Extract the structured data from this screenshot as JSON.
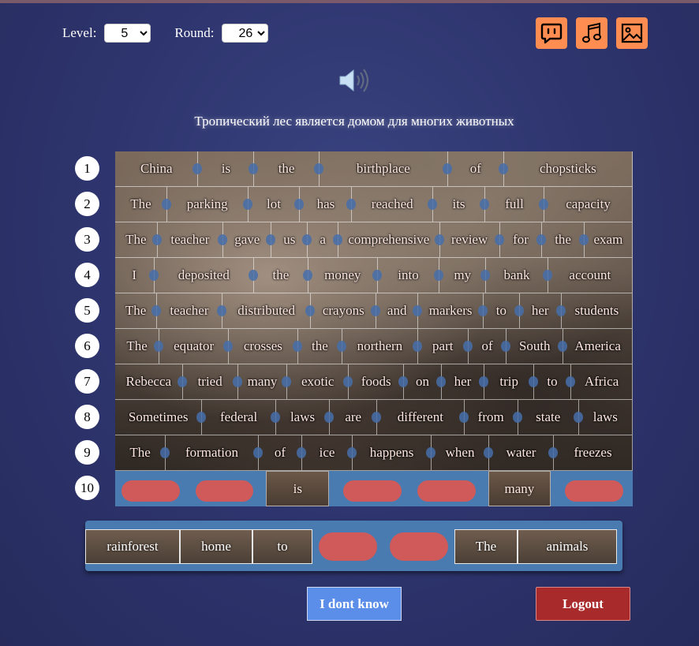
{
  "controls": {
    "level_label": "Level:",
    "level_value": "5",
    "round_label": "Round:",
    "round_value": "26"
  },
  "toolbar": {
    "icons": [
      "translation-hint-icon",
      "music-icon",
      "image-icon"
    ]
  },
  "hint_text": "Тропический лес является домом для многих животных",
  "row_numbers": [
    "1",
    "2",
    "3",
    "4",
    "5",
    "6",
    "7",
    "8",
    "9",
    "10"
  ],
  "rows": [
    [
      "China",
      "is",
      "the",
      "birthplace",
      "of",
      "chopsticks"
    ],
    [
      "The",
      "parking",
      "lot",
      "has",
      "reached",
      "its",
      "full",
      "capacity"
    ],
    [
      "The",
      "teacher",
      "gave",
      "us",
      "a",
      "comprehensive",
      "review",
      "for",
      "the",
      "exam"
    ],
    [
      "I",
      "deposited",
      "the",
      "money",
      "into",
      "my",
      "bank",
      "account"
    ],
    [
      "The",
      "teacher",
      "distributed",
      "crayons",
      "and",
      "markers",
      "to",
      "her",
      "students"
    ],
    [
      "The",
      "equator",
      "crosses",
      "the",
      "northern",
      "part",
      "of",
      "South",
      "America"
    ],
    [
      "Rebecca",
      "tried",
      "many",
      "exotic",
      "foods",
      "on",
      "her",
      "trip",
      "to",
      "Africa"
    ],
    [
      "Sometimes",
      "federal",
      "laws",
      "are",
      "different",
      "from",
      "state",
      "laws"
    ],
    [
      "The",
      "formation",
      "of",
      "ice",
      "happens",
      "when",
      "water",
      "freezes"
    ]
  ],
  "current_row": [
    "",
    "",
    "is",
    "",
    "",
    "many",
    ""
  ],
  "pool": [
    "rainforest",
    "home",
    "to",
    "",
    "",
    "The",
    "animals"
  ],
  "buttons": {
    "dont_know": "I dont know",
    "logout": "Logout"
  },
  "colors": {
    "accent_orange": "#ff8c50",
    "active_row_blue": "#4a7bb0",
    "empty_slot_red": "#d05a5a",
    "dont_know_blue": "#5b8ee8",
    "logout_red": "#a82a2a"
  }
}
